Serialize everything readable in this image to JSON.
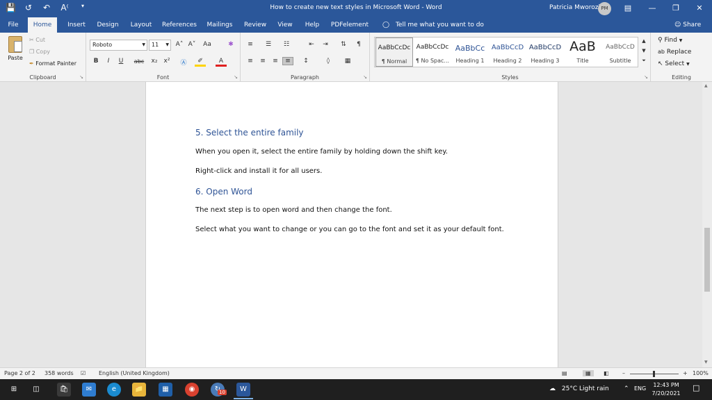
{
  "titlebar": {
    "title": "How to create new text styles in Microsoft Word  -  Word",
    "user": "Patricia Mworozi",
    "avatar": "PM",
    "qat_icons": [
      "save-icon",
      "autosave-icon",
      "undo-icon",
      "read-aloud-icon",
      "customize-qat-icon"
    ]
  },
  "menu": {
    "tabs": [
      "File",
      "Home",
      "Insert",
      "Design",
      "Layout",
      "References",
      "Mailings",
      "Review",
      "View",
      "Help",
      "PDFelement"
    ],
    "active": "Home",
    "tell_me": "Tell me what you want to do",
    "share": "Share"
  },
  "ribbon": {
    "clipboard": {
      "paste": "Paste",
      "cut": "Cut",
      "copy": "Copy",
      "format_painter": "Format Painter",
      "label": "Clipboard"
    },
    "font": {
      "name": "Roboto",
      "size": "11",
      "label": "Font",
      "bold": "B",
      "italic": "I",
      "underline": "U",
      "strike": "abc",
      "subscript": "x₂",
      "superscript": "x²",
      "grow": "A˄",
      "shrink": "A˅",
      "case": "Aa",
      "highlight_color": "#ffd400",
      "font_color": "#e02020"
    },
    "paragraph": {
      "label": "Paragraph"
    },
    "styles": {
      "label": "Styles",
      "items": [
        {
          "sample": "AaBbCcDc",
          "name": "¶ Normal"
        },
        {
          "sample": "AaBbCcDc",
          "name": "¶ No Spac..."
        },
        {
          "sample": "AaBbCc",
          "name": "Heading 1"
        },
        {
          "sample": "AaBbCcD",
          "name": "Heading 2"
        },
        {
          "sample": "AaBbCcD",
          "name": "Heading 3"
        },
        {
          "sample": "AaB",
          "name": "Title"
        },
        {
          "sample": "AaBbCcD",
          "name": "Subtitle"
        }
      ],
      "heading_color": "#2f5496"
    },
    "editing": {
      "label": "Editing",
      "find": "Find",
      "replace": "Replace",
      "select": "Select"
    }
  },
  "document": {
    "items": [
      {
        "kind": "heading",
        "text": "5.  Select the entire family"
      },
      {
        "kind": "para",
        "text": "When you open it, select the entire family by holding down the shift key."
      },
      {
        "kind": "para",
        "text": "Right-click and install it for all users."
      },
      {
        "kind": "heading",
        "text": "6.  Open Word"
      },
      {
        "kind": "para",
        "text": "The next step is to open word and then change the font."
      },
      {
        "kind": "para",
        "text": "Select what you want to change or you can go to the font and set it as your default font."
      }
    ]
  },
  "status": {
    "page": "Page 2 of 2",
    "words": "358 words",
    "language": "English (United Kingdom)",
    "zoom_minus": "–",
    "zoom_plus": "+",
    "zoom": "100%"
  },
  "taskbar": {
    "apps": [
      "windows-start-icon",
      "task-view-icon",
      "store-icon",
      "mail-icon",
      "edge-icon",
      "file-explorer-icon",
      "calculator-icon",
      "chrome-icon",
      "update-icon",
      "word-icon"
    ],
    "badge": "10",
    "weather": "25°C  Light rain",
    "lang": "ENG",
    "time": "12:43 PM",
    "date": "7/20/2021"
  }
}
